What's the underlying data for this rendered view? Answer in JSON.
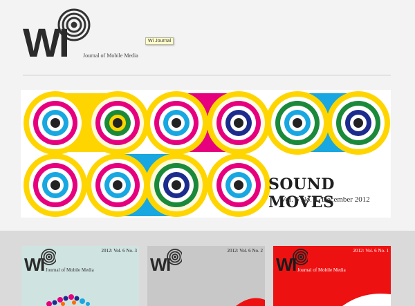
{
  "header": {
    "logo_text": "WI",
    "tagline": "Journal of Mobile Media",
    "tooltip": "Wi Journal"
  },
  "banner": {
    "title": "SOUND MOVES",
    "subtitle": "Vol. 6 No. 4, December 2012"
  },
  "issues": [
    {
      "label": "2012: Vol. 6 No. 3",
      "logo_text": "WI",
      "tagline": "Journal of Mobile Media",
      "background": "#cfe3e0"
    },
    {
      "label": "2012: Vol. 6 No. 2",
      "logo_text": "WI",
      "tagline": "Journal of Mobile Media",
      "background": "#c8c8c8"
    },
    {
      "label": "2012: Vol. 6 No. 1",
      "logo_text": "WI",
      "tagline": "Journal of Mobile Media",
      "background": "#ee1111"
    }
  ],
  "colors": {
    "yellow": "#ffd500",
    "magenta": "#e6007e",
    "cyan": "#18a7e0",
    "green": "#1a8a3a",
    "navy": "#1c2c8c",
    "red": "#ee1111"
  }
}
